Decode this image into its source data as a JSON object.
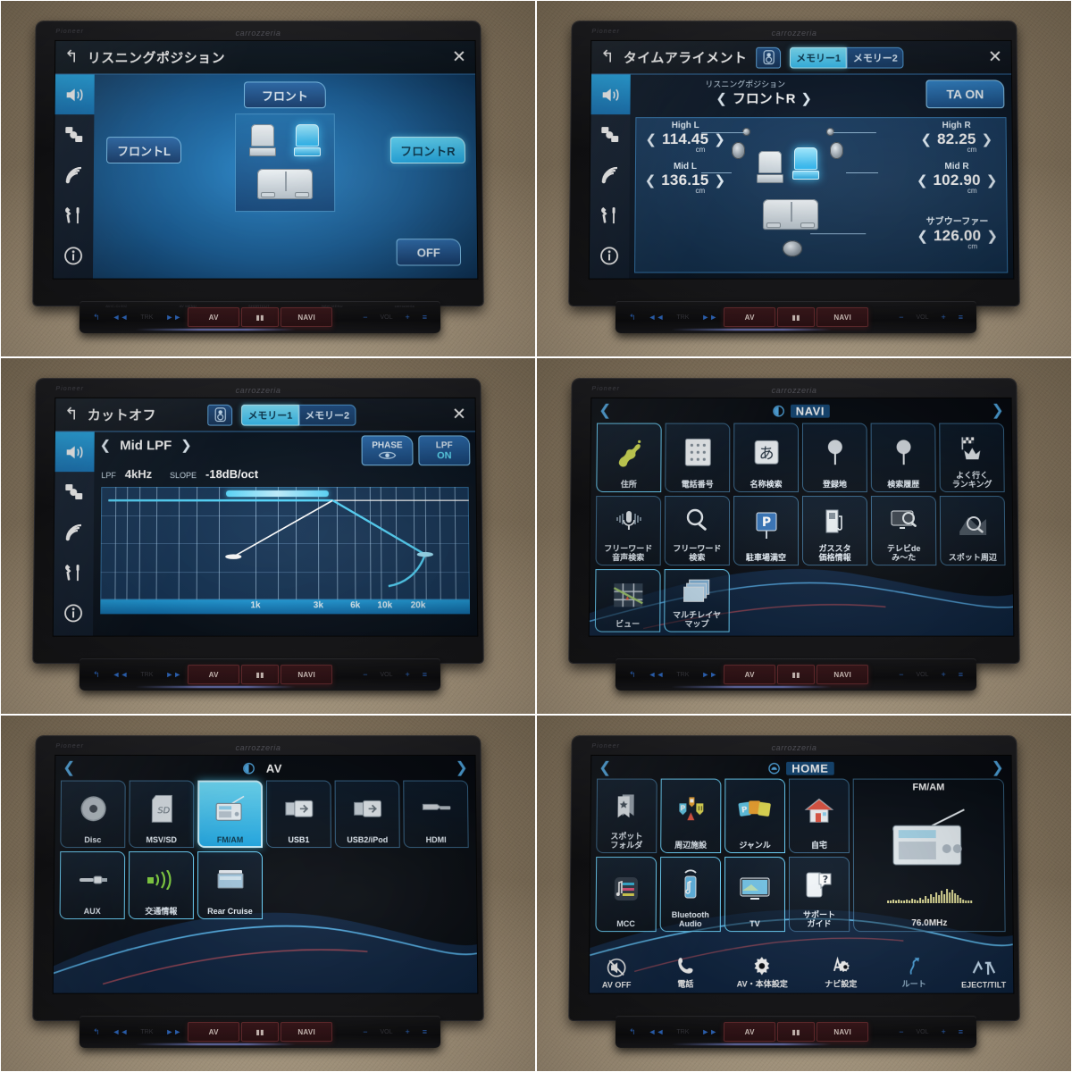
{
  "device": {
    "brand_left": "Pioneer",
    "brand_center": "carrozzeria"
  },
  "hardware_bar": {
    "back": "↰",
    "prev": "◄◄",
    "trk": "TRK",
    "next": "►►",
    "av": "AV",
    "apps": "▮▮",
    "navi": "NAVI",
    "minus": "−",
    "vol": "VOL",
    "plus": "+",
    "menu": "≡"
  },
  "sidebar": {
    "items": [
      {
        "name": "audio-icon",
        "label": "Audio"
      },
      {
        "name": "source-icon",
        "label": "Source"
      },
      {
        "name": "signal-icon",
        "label": "Signal"
      },
      {
        "name": "tools-icon",
        "label": "Tools"
      },
      {
        "name": "info-icon",
        "label": "Info"
      }
    ],
    "selected_index": 0
  },
  "panels": [
    {
      "id": "listening-position",
      "title": "リスニングポジション",
      "back_icon": "↰",
      "close_icon": "✕",
      "buttons": {
        "front": "フロント",
        "front_l": "フロントL",
        "front_r": "フロントR",
        "off": "OFF"
      },
      "selected_button": "フロントR"
    },
    {
      "id": "time-alignment",
      "title": "タイムアライメント",
      "back_icon": "↰",
      "close_icon": "✕",
      "memory_tabs": [
        "メモリー1",
        "メモリー2"
      ],
      "memory_selected": "メモリー1",
      "listening_position_label": "リスニングポジション",
      "listening_position_value": "フロントR",
      "ta_button": "TA ON",
      "unit": "cm",
      "channels": [
        {
          "name": "High L",
          "value": "114.45"
        },
        {
          "name": "Mid L",
          "value": "136.15"
        },
        {
          "name": "High R",
          "value": "82.25"
        },
        {
          "name": "Mid R",
          "value": "102.90"
        },
        {
          "name": "サブウーファー",
          "value": "126.00"
        }
      ]
    },
    {
      "id": "cutoff",
      "title": "カットオフ",
      "back_icon": "↰",
      "close_icon": "✕",
      "memory_tabs": [
        "メモリー1",
        "メモリー2"
      ],
      "memory_selected": "メモリー1",
      "channel": "Mid LPF",
      "filter_key": "LPF",
      "filter_value": "4kHz",
      "slope_key": "SLOPE",
      "slope_value": "-18dB/oct",
      "phase_button": "PHASE",
      "lpf_button_line1": "LPF",
      "lpf_button_line2": "ON",
      "chart_data": {
        "type": "line",
        "title": "カットオフ Mid LPF",
        "xlabel": "",
        "ylabel": "",
        "grid": true,
        "legend": "none",
        "x_ticks": [
          "1k",
          "3k",
          "6k",
          "10k",
          "20k"
        ],
        "x_tick_positions_pct": [
          42,
          59,
          69,
          76,
          85
        ],
        "series": [
          {
            "name": "flat-reference",
            "points": [
              [
                2,
                88
              ],
              [
                100,
                88
              ]
            ]
          },
          {
            "name": "hpf-ramp",
            "points": [
              [
                36,
                38
              ],
              [
                63,
                88
              ]
            ]
          },
          {
            "name": "lpf-slope",
            "points": [
              [
                63,
                88
              ],
              [
                88,
                40
              ]
            ]
          },
          {
            "name": "lpf-tail",
            "points": [
              [
                88,
                40
              ],
              [
                78,
                12
              ],
              [
                92,
                26
              ]
            ]
          }
        ]
      }
    },
    {
      "id": "navi-menu",
      "menu_title": "NAVI",
      "prev_page_icon": "❮",
      "next_page_icon": "❯",
      "tiles": [
        {
          "label": "住所",
          "icon": "japan-map-icon"
        },
        {
          "label": "電話番号",
          "icon": "keypad-icon"
        },
        {
          "label": "名称検索",
          "icon": "kana-a-icon"
        },
        {
          "label": "登録地",
          "icon": "pin-icon"
        },
        {
          "label": "検索履歴",
          "icon": "pin-history-icon"
        },
        {
          "label": "よく行く\nランキング",
          "icon": "flag-crown-icon"
        },
        {
          "label": "フリーワード\n音声検索",
          "icon": "microphone-icon"
        },
        {
          "label": "フリーワード\n検索",
          "icon": "magnifier-icon"
        },
        {
          "label": "駐車場満空",
          "icon": "parking-sign-icon"
        },
        {
          "label": "ガススタ\n価格情報",
          "icon": "gas-pump-icon"
        },
        {
          "label": "テレビde\nみ～た",
          "icon": "tv-search-icon"
        },
        {
          "label": "スポット周辺",
          "icon": "spot-search-icon"
        },
        {
          "label": "ビュー",
          "icon": "map-view-icon"
        },
        {
          "label": "マルチレイヤ\nマップ",
          "icon": "layers-map-icon"
        }
      ],
      "selected_tile": "住所"
    },
    {
      "id": "av-menu",
      "menu_title": "AV",
      "prev_page_icon": "❮",
      "next_page_icon": "❯",
      "tiles": [
        {
          "label": "Disc",
          "icon": "disc-icon"
        },
        {
          "label": "MSV/SD",
          "icon": "sd-card-icon"
        },
        {
          "label": "FM/AM",
          "icon": "radio-icon"
        },
        {
          "label": "USB1",
          "icon": "usb-icon"
        },
        {
          "label": "USB2/iPod",
          "icon": "usb-icon"
        },
        {
          "label": "HDMI",
          "icon": "hdmi-icon"
        },
        {
          "label": "AUX",
          "icon": "aux-plug-icon"
        },
        {
          "label": "交通情報",
          "icon": "traffic-broadcast-icon"
        },
        {
          "label": "Rear Cruise",
          "icon": "rear-monitor-icon"
        }
      ],
      "selected_tile": "FM/AM"
    },
    {
      "id": "home-menu",
      "menu_title": "HOME",
      "prev_page_icon": "❮",
      "next_page_icon": "❯",
      "tiles": [
        {
          "label": "スポット\nフォルダ",
          "icon": "bookmark-star-icon"
        },
        {
          "label": "周辺施設",
          "icon": "poi-pins-icon"
        },
        {
          "label": "ジャンル",
          "icon": "genre-cards-icon"
        },
        {
          "label": "自宅",
          "icon": "home-house-icon"
        },
        {
          "label": "MCC",
          "icon": "mcc-icon"
        },
        {
          "label": "Bluetooth\nAudio",
          "icon": "bluetooth-audio-icon"
        },
        {
          "label": "TV",
          "icon": "tv-icon"
        },
        {
          "label": "サポート\nガイド",
          "icon": "support-guide-icon"
        }
      ],
      "now_playing": {
        "source": "FM/AM",
        "frequency": "76.0MHz",
        "icon": "radio-icon"
      },
      "bottom_bar": [
        {
          "label": "AV OFF",
          "icon": "av-off-icon"
        },
        {
          "label": "電話",
          "icon": "phone-icon"
        },
        {
          "label": "AV・本体設定",
          "icon": "gear-icon"
        },
        {
          "label": "ナビ設定",
          "icon": "nav-gear-icon"
        },
        {
          "label": "ルート",
          "icon": "route-icon"
        },
        {
          "label": "EJECT/TILT",
          "icon": "eject-tilt-icon"
        }
      ]
    }
  ]
}
